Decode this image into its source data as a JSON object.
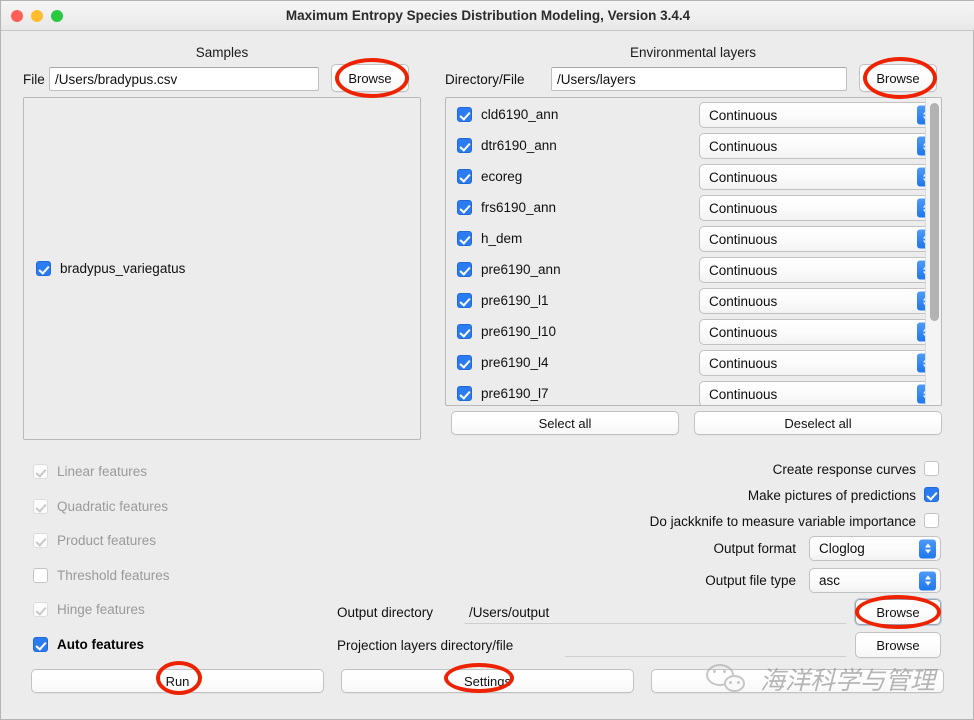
{
  "window": {
    "title": "Maximum Entropy Species Distribution Modeling, Version 3.4.4",
    "traffic_lights": [
      "close-button",
      "minimize-button",
      "zoom-button"
    ]
  },
  "samples": {
    "heading": "Samples",
    "file_label": "File",
    "file_value": "/Users/bradypus.csv",
    "browse_label": "Browse",
    "species": [
      {
        "name": "bradypus_variegatus",
        "checked": true
      }
    ]
  },
  "environmental_layers": {
    "heading": "Environmental layers",
    "directory_label": "Directory/File",
    "directory_value": "/Users/layers",
    "browse_label": "Browse",
    "select_all_label": "Select all",
    "deselect_all_label": "Deselect all",
    "layers": [
      {
        "name": "cld6190_ann",
        "checked": true,
        "type": "Continuous"
      },
      {
        "name": "dtr6190_ann",
        "checked": true,
        "type": "Continuous"
      },
      {
        "name": "ecoreg",
        "checked": true,
        "type": "Continuous"
      },
      {
        "name": "frs6190_ann",
        "checked": true,
        "type": "Continuous"
      },
      {
        "name": "h_dem",
        "checked": true,
        "type": "Continuous"
      },
      {
        "name": "pre6190_ann",
        "checked": true,
        "type": "Continuous"
      },
      {
        "name": "pre6190_l1",
        "checked": true,
        "type": "Continuous"
      },
      {
        "name": "pre6190_l10",
        "checked": true,
        "type": "Continuous"
      },
      {
        "name": "pre6190_l4",
        "checked": true,
        "type": "Continuous"
      },
      {
        "name": "pre6190_l7",
        "checked": true,
        "type": "Continuous"
      }
    ]
  },
  "features": [
    {
      "label": "Linear features",
      "checked": true,
      "enabled": false
    },
    {
      "label": "Quadratic features",
      "checked": true,
      "enabled": false
    },
    {
      "label": "Product features",
      "checked": true,
      "enabled": false
    },
    {
      "label": "Threshold features",
      "checked": false,
      "enabled": false
    },
    {
      "label": "Hinge features",
      "checked": true,
      "enabled": false
    },
    {
      "label": "Auto features",
      "checked": true,
      "enabled": true
    }
  ],
  "options": {
    "create_response_curves": {
      "label": "Create response curves",
      "checked": false
    },
    "make_pictures": {
      "label": "Make pictures of predictions",
      "checked": true
    },
    "do_jackknife": {
      "label": "Do jackknife to measure variable importance",
      "checked": false
    },
    "output_format": {
      "label": "Output format",
      "value": "Cloglog"
    },
    "output_file_type": {
      "label": "Output file type",
      "value": "asc"
    }
  },
  "paths": {
    "output_directory_label": "Output directory",
    "output_directory_value": "/Users/output",
    "output_browse_label": "Browse",
    "projection_label": "Projection layers directory/file",
    "projection_value": "",
    "projection_browse_label": "Browse"
  },
  "bottom_buttons": {
    "run_label": "Run",
    "settings_label": "Settings",
    "help_label": ""
  },
  "watermark": {
    "text": "海洋科学与管理",
    "logo": "wechat-logo"
  },
  "colors": {
    "accent_blue": "#2b7bf3",
    "annotation_red": "#ee2200",
    "window_bg": "#ececec"
  }
}
